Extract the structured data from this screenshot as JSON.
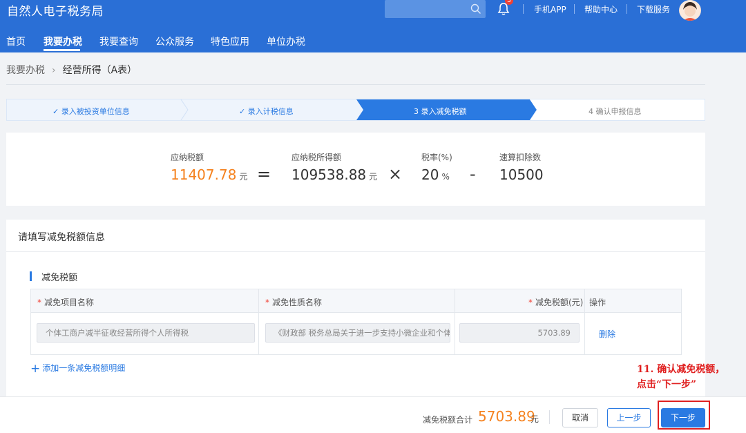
{
  "header": {
    "brand": "自然人电子税务局",
    "search_placeholder": "",
    "notification_count": "3",
    "links": [
      "手机APP",
      "帮助中心",
      "下载服务"
    ],
    "nav": [
      "首页",
      "我要办税",
      "我要查询",
      "公众服务",
      "特色应用",
      "单位办税"
    ],
    "active_nav": "我要办税"
  },
  "breadcrumb": {
    "root": "我要办税",
    "current": "经营所得（A表）"
  },
  "steps": [
    {
      "label": "✓ 录入被投资单位信息",
      "state": "done"
    },
    {
      "label": "✓ 录入计税信息",
      "state": "done"
    },
    {
      "label": "3  录入减免税额",
      "state": "current"
    },
    {
      "label": "4  确认申报信息",
      "state": "pending"
    }
  ],
  "formula": {
    "tax_payable_label": "应纳税额",
    "tax_payable_value": "11407.78",
    "tax_payable_unit": "元",
    "taxable_income_label": "应纳税所得额",
    "taxable_income_value": "109538.88",
    "taxable_income_unit": "元",
    "rate_label": "税率(%)",
    "rate_value": "20",
    "rate_unit": "%",
    "deduction_label": "速算扣除数",
    "deduction_value": "10500",
    "op_equals": "=",
    "op_times": "×",
    "op_minus": "-"
  },
  "relief": {
    "card_title": "请填写减免税额信息",
    "section_title": "减免税额",
    "columns": [
      "减免项目名称",
      "减免性质名称",
      "减免税额(元)",
      "操作"
    ],
    "rows": [
      {
        "item_name": "个体工商户减半征收经营所得个人所得税",
        "nature_name": "《财政部 税务总局关于进一步支持小微企业和个体工商户发展有关税费政策的公告》",
        "amount": "5703.89",
        "action": "删除"
      }
    ],
    "add_label": "添加一条减免税额明细"
  },
  "footer": {
    "total_label": "减免税额合计",
    "total_value": "5703.89",
    "total_unit": "元",
    "cancel_label": "取消",
    "prev_label": "上一步",
    "next_label": "下一步"
  },
  "annotation": {
    "line1": "11. 确认减免税额，",
    "line2": "点击“下一步”"
  },
  "colors": {
    "brand_blue": "#2a6fd6",
    "accent_blue": "#2a7ae2",
    "orange": "#f5821f",
    "callout_red": "#e02020"
  }
}
